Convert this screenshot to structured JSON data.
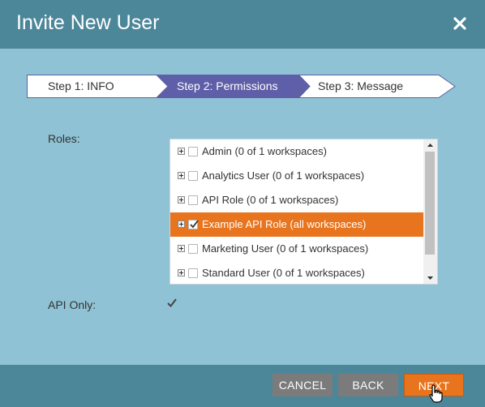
{
  "dialog": {
    "title": "Invite New User"
  },
  "steps": [
    {
      "label": "Step 1: INFO",
      "active": false
    },
    {
      "label": "Step 2: Permissions",
      "active": true
    },
    {
      "label": "Step 3: Message",
      "active": false
    }
  ],
  "form": {
    "roles_label": "Roles:",
    "api_only_label": "API Only:",
    "api_only_checked": true
  },
  "roles": [
    {
      "label": "Admin (0 of 1 workspaces)",
      "checked": false,
      "selected": false
    },
    {
      "label": "Analytics User (0 of 1 workspaces)",
      "checked": false,
      "selected": false
    },
    {
      "label": "API Role (0 of 1 workspaces)",
      "checked": false,
      "selected": false
    },
    {
      "label": "Example API Role (all workspaces)",
      "checked": true,
      "selected": true
    },
    {
      "label": "Marketing User (0 of 1 workspaces)",
      "checked": false,
      "selected": false
    },
    {
      "label": "Standard User (0 of 1 workspaces)",
      "checked": false,
      "selected": false
    }
  ],
  "footer": {
    "cancel_label": "CANCEL",
    "back_label": "BACK",
    "next_label": "NEXT"
  },
  "colors": {
    "header": "#4c8699",
    "body": "#8fc2d4",
    "active_step": "#5f5ea8",
    "accent": "#e8741e",
    "secondary_button": "#7b7b7b"
  },
  "icons": {
    "close": "close-icon",
    "expand": "plus-box-icon",
    "check": "checkmark-icon",
    "cursor": "hand-pointer-icon"
  }
}
